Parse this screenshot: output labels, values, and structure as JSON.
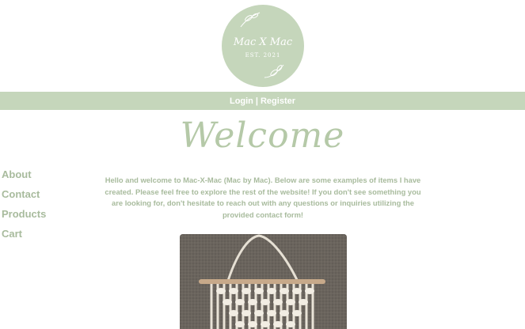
{
  "logo": {
    "title": "Mac X Mac",
    "subtitle": "EST. 2021"
  },
  "auth": {
    "login": "Login",
    "separator": "|",
    "register": "Register"
  },
  "welcome": {
    "heading": "Welcome"
  },
  "nav": {
    "items": [
      "About",
      "Contact",
      "Products",
      "Cart"
    ]
  },
  "intro": {
    "text": "Hello and welcome to Mac-X-Mac (Mac by Mac). Below are some examples of items I have created. Please feel free to explore the rest of the website! If you don't see something you are looking for, don't hesitate to reach out with any questions or inquiries utilizing the provided contact form!"
  },
  "colors": {
    "accent": "#c5d6bb",
    "text": "#a8bb9d",
    "welcome": "#b5c9a8"
  },
  "image": {
    "subject": "macrame-wall-hanging"
  }
}
